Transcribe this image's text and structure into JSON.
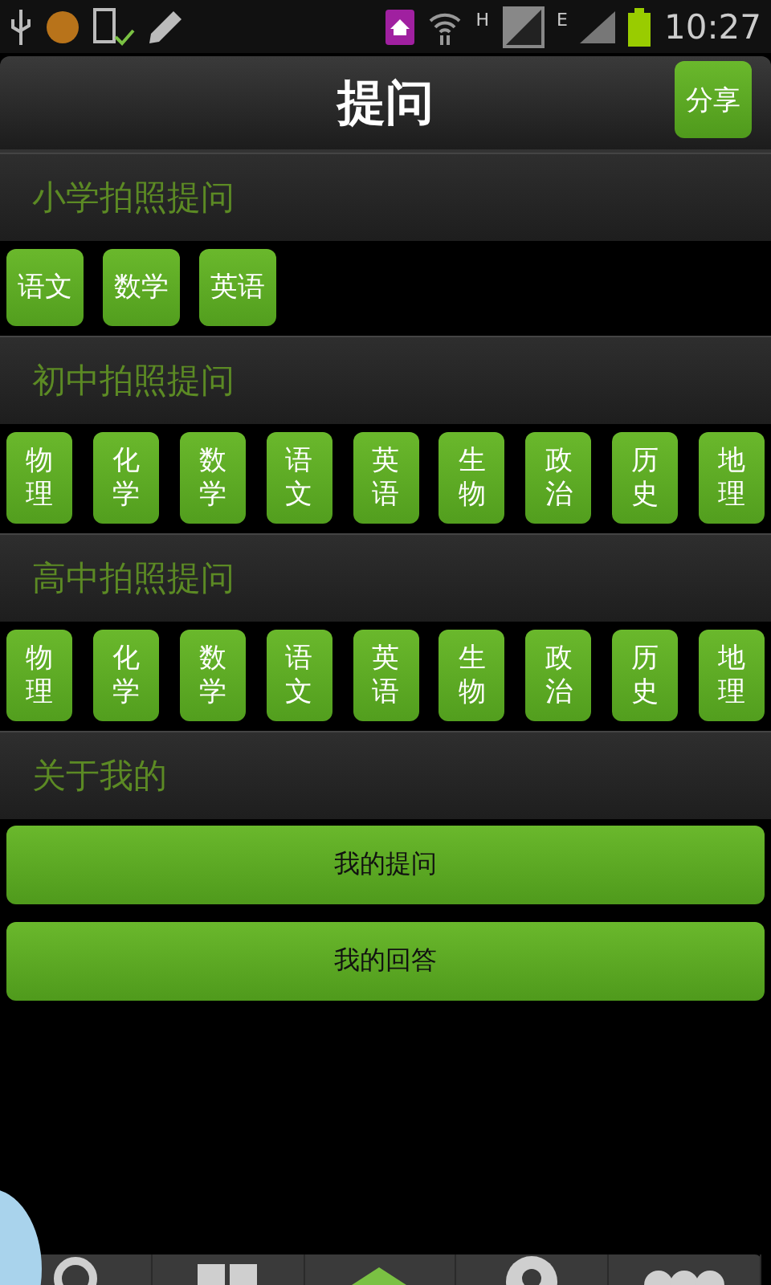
{
  "status_bar": {
    "network_h": "H",
    "network_e": "E",
    "time": "10:27"
  },
  "header": {
    "title": "提问",
    "share_button": "分享"
  },
  "sections": [
    {
      "title": "小学拍照提问",
      "kind": "subjects-inline",
      "items": [
        "语文",
        "数学",
        "英语"
      ]
    },
    {
      "title": "初中拍照提问",
      "kind": "subjects-stacked",
      "items": [
        "物理",
        "化学",
        "数学",
        "语文",
        "英语",
        "生物",
        "政治",
        "历史",
        "地理"
      ]
    },
    {
      "title": "高中拍照提问",
      "kind": "subjects-stacked",
      "items": [
        "物理",
        "化学",
        "数学",
        "语文",
        "英语",
        "生物",
        "政治",
        "历史",
        "地理"
      ]
    },
    {
      "title": "关于我的",
      "kind": "actions",
      "items": [
        "我的提问",
        "我的回答"
      ]
    }
  ],
  "bottom_tabs": [
    {
      "kind": "search",
      "selected": false
    },
    {
      "kind": "grid",
      "selected": false
    },
    {
      "kind": "up",
      "selected": true
    },
    {
      "kind": "person",
      "selected": false
    },
    {
      "kind": "dots",
      "selected": false
    }
  ]
}
